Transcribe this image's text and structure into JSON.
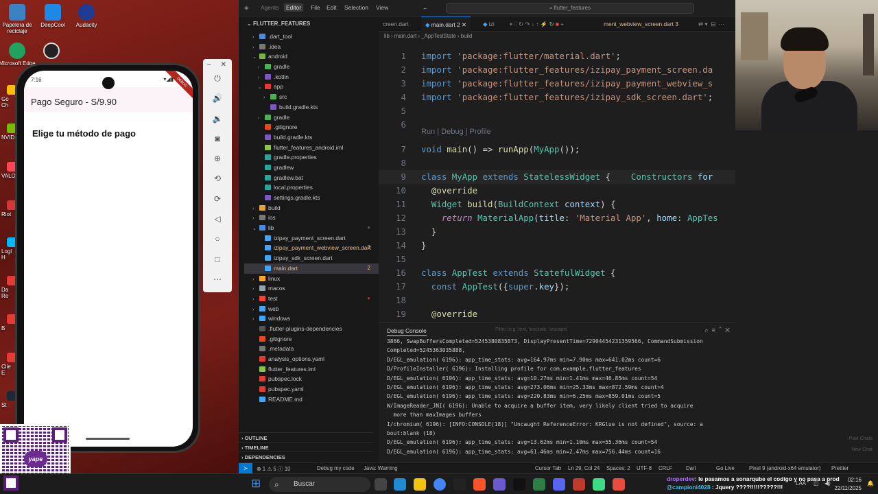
{
  "desktop": {
    "icons": [
      {
        "label": "Papelera de reciclaje",
        "color": "#3b82c4"
      },
      {
        "label": "DeepCool",
        "color": "#1e88e5"
      },
      {
        "label": "Audacity",
        "color": "#1f3a93"
      },
      {
        "label": "Microsoft Edge",
        "color": "#1fa35e"
      }
    ],
    "edge_labels": [
      "Go\nCh",
      "NVID",
      "VALO",
      "Riot",
      "Logi\nH",
      "Da\nRe",
      "B",
      "Clie\nE",
      "St"
    ]
  },
  "phone": {
    "time": "7:16",
    "status_icons": "▾◢▮",
    "debug_ribbon": "DEBUG",
    "appbar_title": "Pago Seguro - S/9.90",
    "heading": "Elige tu método de pago"
  },
  "emulator_toolbar": {
    "buttons": [
      "power-icon",
      "volume-up-icon",
      "volume-down-icon",
      "camera-icon",
      "zoom-icon",
      "rotate-left-icon",
      "rotate-right-icon",
      "back-icon",
      "home-icon",
      "overview-icon",
      "more-icon"
    ]
  },
  "qr": {
    "logo_text": "yape"
  },
  "ide": {
    "menu": [
      "Agents",
      "Editor",
      "File",
      "Edit",
      "Selection",
      "View"
    ],
    "command_center": "flutter_features",
    "explorer_title": "FLUTTER_FEATURES",
    "tree": [
      {
        "name": ".dart_tool",
        "depth": 1,
        "folder": true,
        "open": false,
        "color": "#c5c5c5",
        "icon": "#4e8bdc"
      },
      {
        "name": ".idea",
        "depth": 1,
        "folder": true,
        "open": false,
        "color": "#c5c5c5",
        "icon": "#777"
      },
      {
        "name": "android",
        "depth": 1,
        "folder": true,
        "open": true,
        "color": "#c5c5c5",
        "icon": "#7cb342"
      },
      {
        "name": "gradle",
        "depth": 2,
        "folder": true,
        "open": false,
        "color": "#c5c5c5",
        "icon": "#4caf50"
      },
      {
        "name": ".kotlin",
        "depth": 2,
        "folder": true,
        "open": false,
        "color": "#c5c5c5",
        "icon": "#7e57c2"
      },
      {
        "name": "app",
        "depth": 2,
        "folder": true,
        "open": true,
        "color": "#c5c5c5",
        "icon": "#e53935"
      },
      {
        "name": "src",
        "depth": 3,
        "folder": true,
        "open": false,
        "color": "#c5c5c5",
        "icon": "#4caf50"
      },
      {
        "name": "build.gradle.kts",
        "depth": 3,
        "folder": false,
        "color": "#c5c5c5",
        "icon": "#7e57c2"
      },
      {
        "name": "gradle",
        "depth": 2,
        "folder": true,
        "open": false,
        "color": "#c5c5c5",
        "icon": "#4caf50"
      },
      {
        "name": ".gitignore",
        "depth": 2,
        "folder": false,
        "color": "#c5c5c5",
        "icon": "#e64a19"
      },
      {
        "name": "build.gradle.kts",
        "depth": 2,
        "folder": false,
        "color": "#c5c5c5",
        "icon": "#7e57c2"
      },
      {
        "name": "flutter_features_android.iml",
        "depth": 2,
        "folder": false,
        "color": "#c5c5c5",
        "icon": "#8bc34a"
      },
      {
        "name": "gradle.properties",
        "depth": 2,
        "folder": false,
        "color": "#c5c5c5",
        "icon": "#26a69a"
      },
      {
        "name": "gradlew",
        "depth": 2,
        "folder": false,
        "color": "#c5c5c5",
        "icon": "#26a69a"
      },
      {
        "name": "gradlew.bat",
        "depth": 2,
        "folder": false,
        "color": "#c5c5c5",
        "icon": "#26a69a"
      },
      {
        "name": "local.properties",
        "depth": 2,
        "folder": false,
        "color": "#c5c5c5",
        "icon": "#26a69a"
      },
      {
        "name": "settings.gradle.kts",
        "depth": 2,
        "folder": false,
        "color": "#c5c5c5",
        "icon": "#7e57c2"
      },
      {
        "name": "build",
        "depth": 1,
        "folder": true,
        "open": false,
        "color": "#c5c5c5",
        "icon": "#e6a23c"
      },
      {
        "name": "ios",
        "depth": 1,
        "folder": true,
        "open": false,
        "color": "#c5c5c5",
        "icon": "#777"
      },
      {
        "name": "lib",
        "depth": 1,
        "folder": true,
        "open": true,
        "color": "#c5c5c5",
        "icon": "#4e8bdc",
        "dot": "#555"
      },
      {
        "name": "izipay_payment_screen.dart",
        "depth": 2,
        "folder": false,
        "color": "#c5c5c5",
        "icon": "#42a5f5"
      },
      {
        "name": "izipay_payment_webview_screen.dart",
        "depth": 2,
        "folder": false,
        "color": "#e2c08d",
        "icon": "#42a5f5",
        "badge": "3",
        "badge_color": "#e2c08d"
      },
      {
        "name": "izipay_sdk_screen.dart",
        "depth": 2,
        "folder": false,
        "color": "#c5c5c5",
        "icon": "#42a5f5"
      },
      {
        "name": "main.dart",
        "depth": 2,
        "folder": false,
        "color": "#e2c08d",
        "icon": "#42a5f5",
        "badge": "2",
        "badge_color": "#e2c08d",
        "selected": true
      },
      {
        "name": "linux",
        "depth": 1,
        "folder": true,
        "open": false,
        "color": "#c5c5c5",
        "icon": "#ffa726"
      },
      {
        "name": "macos",
        "depth": 1,
        "folder": true,
        "open": false,
        "color": "#c5c5c5",
        "icon": "#90a4ae"
      },
      {
        "name": "test",
        "depth": 1,
        "folder": true,
        "open": false,
        "color": "#c5c5c5",
        "icon": "#f44336",
        "dot": "#a33"
      },
      {
        "name": "web",
        "depth": 1,
        "folder": true,
        "open": false,
        "color": "#c5c5c5",
        "icon": "#42a5f5"
      },
      {
        "name": "windows",
        "depth": 1,
        "folder": true,
        "open": false,
        "color": "#c5c5c5",
        "icon": "#42a5f5"
      },
      {
        "name": ".flutter-plugins-dependencies",
        "depth": 1,
        "folder": false,
        "color": "#c5c5c5",
        "icon": "#555"
      },
      {
        "name": ".gitignore",
        "depth": 1,
        "folder": false,
        "color": "#c5c5c5",
        "icon": "#e64a19"
      },
      {
        "name": ".metadata",
        "depth": 1,
        "folder": false,
        "color": "#c5c5c5",
        "icon": "#777"
      },
      {
        "name": "analysis_options.yaml",
        "depth": 1,
        "folder": false,
        "color": "#c5c5c5",
        "icon": "#e53935"
      },
      {
        "name": "flutter_features.iml",
        "depth": 1,
        "folder": false,
        "color": "#c5c5c5",
        "icon": "#8bc34a"
      },
      {
        "name": "pubspec.lock",
        "depth": 1,
        "folder": false,
        "color": "#c5c5c5",
        "icon": "#e53935"
      },
      {
        "name": "pubspec.yaml",
        "depth": 1,
        "folder": false,
        "color": "#c5c5c5",
        "icon": "#e53935"
      },
      {
        "name": "README.md",
        "depth": 1,
        "folder": false,
        "color": "#c5c5c5",
        "icon": "#42a5f5"
      }
    ],
    "bottom_sections": [
      "OUTLINE",
      "TIMELINE",
      "DEPENDENCIES"
    ],
    "tabs": [
      {
        "label": "creen.dart",
        "active": false
      },
      {
        "label": "main.dart 2",
        "active": true
      },
      {
        "label": "izi",
        "active": false
      },
      {
        "label": "ment_webview_screen.dart  3",
        "active": false
      }
    ],
    "breadcrumb": "lib  ›  main.dart  ›  _AppTestState  ›  build",
    "codelens": "Run | Debug | Profile",
    "code_lines": [
      {
        "n": "1",
        "text": "import 'package:flutter/material.dart';"
      },
      {
        "n": "2",
        "text": "import 'package:flutter_features/izipay_payment_screen.da"
      },
      {
        "n": "3",
        "text": "import 'package:flutter_features/izipay_payment_webview_s"
      },
      {
        "n": "4",
        "text": "import 'package:flutter_features/izipay_sdk_screen.dart';"
      },
      {
        "n": "5",
        "text": ""
      },
      {
        "n": "6",
        "text": ""
      },
      {
        "n": "7",
        "text": "void main() => runApp(MyApp());"
      },
      {
        "n": "8",
        "text": ""
      },
      {
        "n": "9",
        "text": "class MyApp extends StatelessWidget {    Constructors for"
      },
      {
        "n": "10",
        "text": "  @override"
      },
      {
        "n": "11",
        "text": "  Widget build(BuildContext context) {"
      },
      {
        "n": "12",
        "text": "    return MaterialApp(title: 'Material App', home: AppTes"
      },
      {
        "n": "13",
        "text": "  }"
      },
      {
        "n": "14",
        "text": "}"
      },
      {
        "n": "15",
        "text": ""
      },
      {
        "n": "16",
        "text": "class AppTest extends StatefulWidget {"
      },
      {
        "n": "17",
        "text": "  const AppTest({super.key});"
      },
      {
        "n": "18",
        "text": ""
      },
      {
        "n": "19",
        "text": "  @override"
      }
    ],
    "panel_title": "Debug Console",
    "panel_filter": "Filter (e.g. text, !exclude, \\escape)",
    "console": [
      "3866, SwapBuffersCompleted=5245380835873, DisplayPresentTime=72904454231359566, CommandSubmission",
      "Completed=5245363035888,",
      "D/EGL_emulation( 6196): app_time_stats: avg=164.97ms min=7.90ms max=641.02ms count=6",
      "D/ProfileInstaller( 6196): Installing profile for com.example.flutter_features",
      "D/EGL_emulation( 6196): app_time_stats: avg=10.27ms min=1.41ms max=46.85ms count=54",
      "D/EGL_emulation( 6196): app_time_stats: avg=273.06ms min=25.33ms max=872.59ms count=4",
      "D/EGL_emulation( 6196): app_time_stats: avg=220.83ms min=6.25ms max=859.01ms count=5",
      "W/ImageReader_JNI( 6196): Unable to acquire a buffer item, very likely client tried to acquire",
      "  more than maxImages buffers",
      "I/chromium( 6196): [INFO:CONSOLE(18)] \"Uncaught ReferenceError: KRGlue is not defined\", source: a",
      "bout:blank (18)",
      "D/EGL_emulation( 6196): app_time_stats: avg=13.62ms min=1.10ms max=55.36ms count=54",
      "D/EGL_emulation( 6196): app_time_stats: avg=61.46ms min=2.47ms max=756.44ms count=16"
    ],
    "status": {
      "errors": "⊗ 1 ⚠ 5 ⓘ 10",
      "debug": "Debug my code",
      "java": "Java: Warning",
      "cursor_tab": "Cursor Tab",
      "position": "Ln 29, Col 24",
      "spaces": "Spaces: 2",
      "encoding": "UTF-8",
      "eol": "CRLF",
      "lang": "Dart",
      "golive": "Go Live",
      "device": "Pixel 9 (android-x64 emulator)",
      "prettier": "Prettier"
    }
  },
  "webcam_overlay": {
    "chat1": "Past Chats",
    "chat2": "New Chat",
    "time": "10h"
  },
  "taskbar": {
    "search": "Buscar",
    "clock_time": "02:16",
    "clock_date": "22/11/2025",
    "lang": "LAA"
  },
  "twitch": [
    {
      "user": "droperdev",
      "msg": ": le pasamos a sonarqube el codigo y no pasa a prod"
    },
    {
      "user": "@campioni4028",
      "msg": " : Jquery ????!!!!!?????!!!"
    }
  ]
}
